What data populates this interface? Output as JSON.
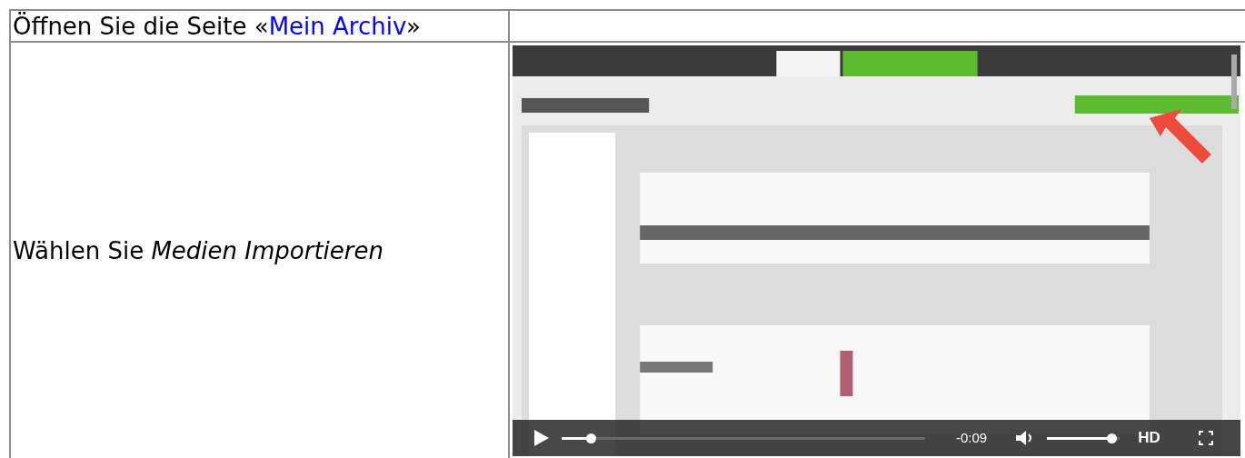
{
  "steps": [
    {
      "before": "Öffnen Sie die Seite «",
      "link": "Mein Archiv",
      "after": "»"
    },
    {
      "instruction": "Wählen Sie *Medien Importieren*",
      "video": {
        "kind": "picture",
        "playing": false,
        "progress": {
          "level": 0.07
        },
        "time": "-0:09",
        "volume": {
          "level": 0.96
        },
        "quality": "HD"
      }
    }
  ]
}
